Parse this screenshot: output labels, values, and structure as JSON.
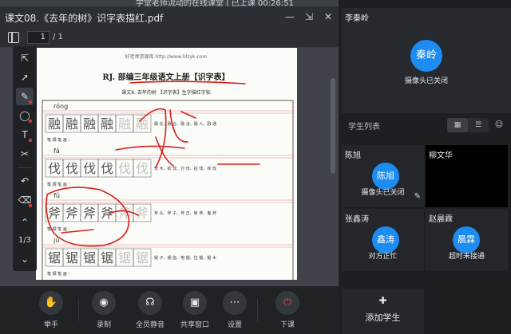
{
  "app_strip_text": "学堂老师流动的在线课堂 | 已上课 00:26:51",
  "document": {
    "title": "课文08.《去年的树》识字表描红.pdf",
    "page_input": "1",
    "page_total": "/ 1"
  },
  "annotation_tools": [
    {
      "icon": "cursor-select-icon"
    },
    {
      "icon": "arrow-icon"
    },
    {
      "icon": "pen-icon"
    },
    {
      "icon": "shapes-icon"
    },
    {
      "icon": "text-icon"
    },
    {
      "icon": "scissors-icon"
    },
    {
      "icon": "undo-icon"
    },
    {
      "icon": "eraser-icon"
    }
  ],
  "page_counter": "1/3",
  "pdf": {
    "site_header": "好老师资源库 http://www.hlzyk.com",
    "title": "RJ. 部编三年级语文上册【识字表】",
    "subtitle": "课文8.  去年的树 【识字表】生字描红字帖",
    "rows": [
      {
        "pinyin": "róng",
        "char": "融",
        "words": "融 化、融 合、融 洽、融 入、融 通"
      },
      {
        "pinyin": "fá",
        "char": "伐",
        "words": "伐 木、砍 伐、讨 伐、征 伐、攻 伐"
      },
      {
        "pinyin": "fǔ",
        "char": "斧",
        "words": "斧 头、斧 子、斧 正、板 斧、鬼 斧"
      },
      {
        "pinyin": "jù",
        "char": "锯",
        "words": "锯 子、锯 齿、电 锯、拉 锯、锯 木"
      }
    ],
    "strokes_label": "笔 顺 笔 画 ：",
    "accent_colors": {
      "text": "#222222",
      "pinyin_line": "#e06b6b",
      "handwriting": "#d8201c"
    }
  },
  "controls": [
    {
      "icon": "raise-hand-icon",
      "label": "举手"
    },
    {
      "icon": "record-icon",
      "label": "录制"
    },
    {
      "icon": "mute-all-icon",
      "label": "全员静音"
    },
    {
      "icon": "share-window-icon",
      "label": "共享窗口"
    },
    {
      "icon": "settings-dots-icon",
      "label": "设置"
    },
    {
      "icon": "power-icon",
      "label": "下课"
    }
  ],
  "teacher": {
    "name": "李秦岭",
    "avatar_text": "秦岭",
    "status": "摄像头已关闭"
  },
  "student_list": {
    "title": "学生列表",
    "students": [
      {
        "name": "陈旭",
        "avatar_text": "陈旭",
        "status": "摄像头已关闭"
      },
      {
        "name": "柳文华",
        "avatar_text": "",
        "status": ""
      },
      {
        "name": "张鑫涛",
        "avatar_text": "鑫涛",
        "status": "对方正忙"
      },
      {
        "name": "赵晨霖",
        "avatar_text": "晨霖",
        "status": "超时未接通"
      }
    ]
  },
  "add_student_label": "添加学生",
  "colors": {
    "accent_blue": "#1c8cf2",
    "end_red": "#e2463b"
  }
}
